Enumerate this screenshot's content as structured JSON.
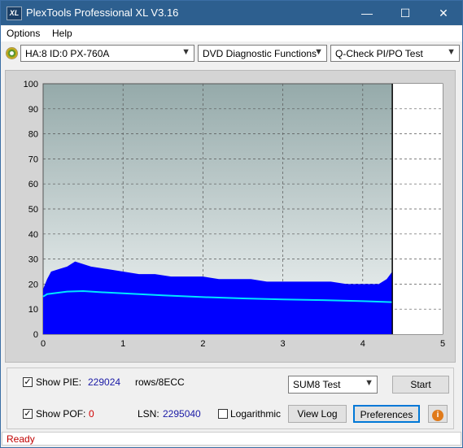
{
  "window": {
    "title": "PlexTools Professional XL V3.16",
    "app_icon": "XL"
  },
  "controls": {
    "minimize": "—",
    "maximize": "☐",
    "close": "✕"
  },
  "menu": {
    "options": "Options",
    "help": "Help"
  },
  "toolbar": {
    "drive": "HA:8 ID:0  PX-760A",
    "function": "DVD Diagnostic Functions",
    "test": "Q-Check PI/PO Test"
  },
  "chart_data": {
    "type": "area",
    "title": "",
    "xlabel": "",
    "ylabel": "",
    "xlim": [
      0,
      5
    ],
    "ylim": [
      0,
      100
    ],
    "x_ticks": [
      "0",
      "1",
      "2",
      "3",
      "4",
      "5"
    ],
    "y_ticks": [
      "0",
      "10",
      "20",
      "30",
      "40",
      "50",
      "60",
      "70",
      "80",
      "90",
      "100"
    ],
    "grid": true,
    "end_marker_x": 4.37,
    "colors": {
      "bars": "#0000ff",
      "line": "#00e5ff"
    },
    "series": [
      {
        "values_x": [
          0,
          0.05,
          0.1,
          0.2,
          0.3,
          0.4,
          0.5,
          0.6,
          0.8,
          1.0,
          1.2,
          1.4,
          1.6,
          1.8,
          2.0,
          2.2,
          2.4,
          2.6,
          2.8,
          3.0,
          3.2,
          3.4,
          3.6,
          3.8,
          4.0,
          4.2,
          4.3,
          4.37
        ],
        "values_y": [
          18,
          22,
          25,
          26,
          27,
          29,
          28,
          27,
          26,
          25,
          24,
          24,
          23,
          23,
          23,
          22,
          22,
          22,
          21,
          21,
          21,
          21,
          21,
          20,
          20,
          20,
          22,
          25
        ]
      },
      {
        "values_x": [
          0,
          0.05,
          0.1,
          0.3,
          0.5,
          0.7,
          1.0,
          1.5,
          2.0,
          2.5,
          3.0,
          3.5,
          4.0,
          4.37
        ],
        "values_y": [
          15,
          16,
          16.2,
          17,
          17.2,
          16.8,
          16.3,
          15.5,
          14.8,
          14.3,
          13.9,
          13.6,
          13.2,
          12.8
        ]
      }
    ]
  },
  "bottom": {
    "show_pie_label": "Show PIE:",
    "pie_value": "229024",
    "rows_label": "rows/8ECC",
    "show_pof_label": "Show POF:",
    "pof_value": "0",
    "lsn_label": "LSN:",
    "lsn_value": "2295040",
    "logarithmic_label": "Logarithmic",
    "test_select": "SUM8 Test",
    "start_button": "Start",
    "view_log_button": "View Log",
    "preferences_button": "Preferences",
    "info_icon": "i",
    "check_mark": "✓"
  },
  "status": {
    "text": "Ready"
  }
}
